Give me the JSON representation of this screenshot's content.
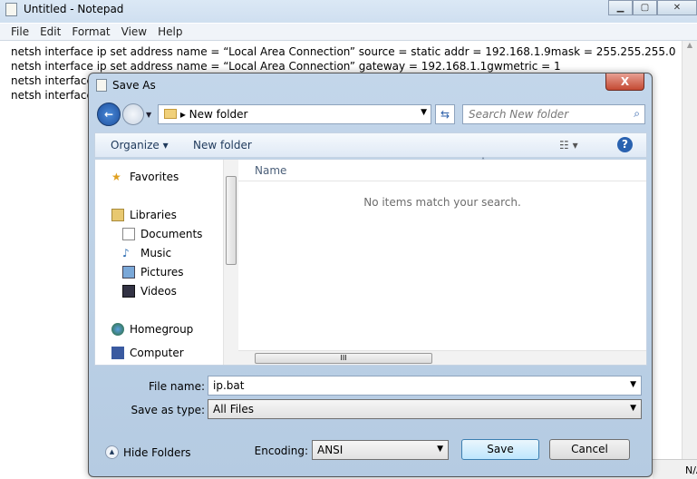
{
  "notepad": {
    "title": "Untitled - Notepad",
    "menu": [
      "File",
      "Edit",
      "Format",
      "View",
      "Help"
    ],
    "lines": [
      "netsh interface ip set address name = “Local Area Connection” source = static addr = 192.168.1.9mask = 255.255.255.0",
      "netsh interface ip set address name = “Local Area Connection” gateway = 192.168.1.1gwmetric = 1",
      "netsh interface",
      "netsh interface"
    ],
    "status": "N/A"
  },
  "dialog": {
    "title": "Save As",
    "close": "X",
    "address": "New folder",
    "search_placeholder": "Search New folder",
    "toolbar": {
      "organize": "Organize ▾",
      "new_folder": "New folder"
    },
    "nav": [
      {
        "label": "Favorites",
        "icon": "star-icon"
      },
      {
        "label": "Libraries",
        "icon": "libraries-icon"
      },
      {
        "label": "Documents",
        "icon": "documents-icon"
      },
      {
        "label": "Music",
        "icon": "music-icon"
      },
      {
        "label": "Pictures",
        "icon": "pictures-icon"
      },
      {
        "label": "Videos",
        "icon": "videos-icon"
      },
      {
        "label": "Homegroup",
        "icon": "homegroup-icon"
      },
      {
        "label": "Computer",
        "icon": "computer-icon"
      }
    ],
    "column_name": "Name",
    "empty_message": "No items match your search.",
    "file_name_label": "File name:",
    "file_name": "ip.bat",
    "save_type_label": "Save as type:",
    "save_type": "All Files",
    "encoding_label": "Encoding:",
    "encoding": "ANSI",
    "hide_folders": "Hide Folders",
    "save": "Save",
    "cancel": "Cancel"
  }
}
